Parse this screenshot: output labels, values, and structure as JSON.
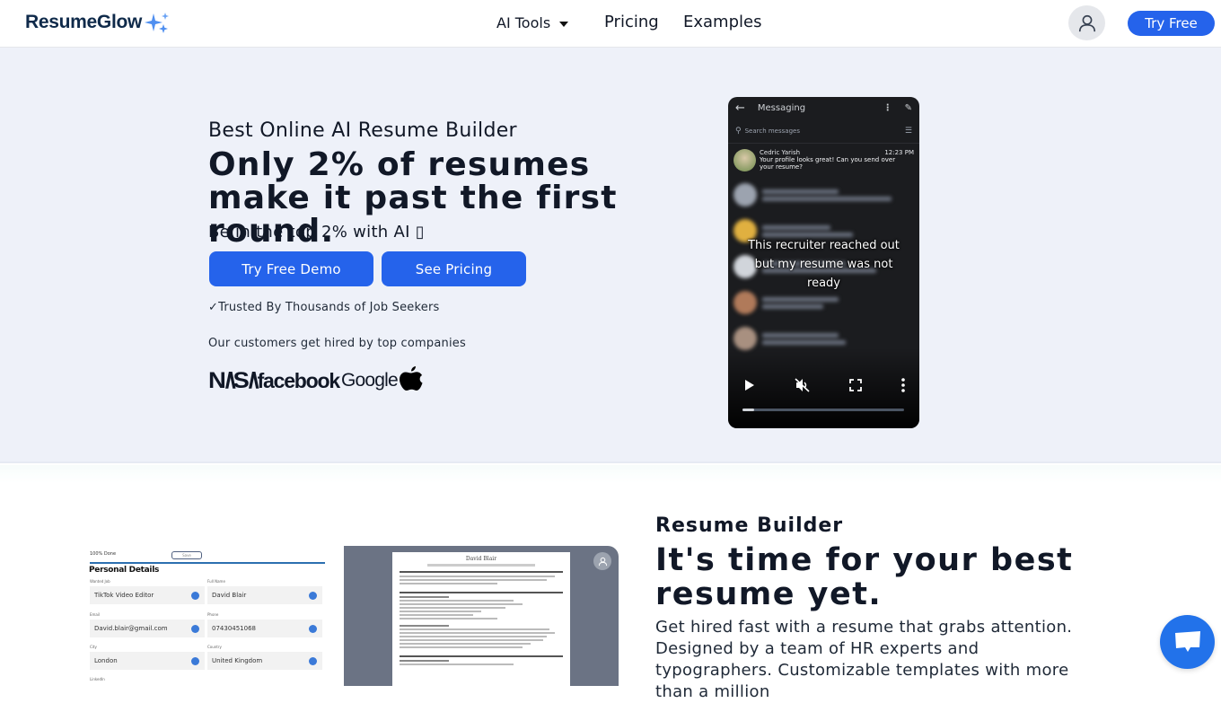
{
  "nav": {
    "brand": "ResumeGlow",
    "items": [
      {
        "label": "AI Tools",
        "has_dropdown": true
      },
      {
        "label": "Pricing"
      },
      {
        "label": "Examples"
      }
    ],
    "cta": "Try Free"
  },
  "hero": {
    "eyebrow": "Best Online AI Resume Builder",
    "headline": "Only 2% of resumes make it past the first round.",
    "subline": "Be in the top 2% with AI ▯",
    "buttons": {
      "demo": "Try Free Demo",
      "pricing": "See Pricing"
    },
    "trusted": "✓Trusted By Thousands of Job Seekers",
    "companies_label": "Our customers get hired by top companies",
    "company_logos": [
      "NASA",
      "facebook",
      "Google",
      "Apple"
    ],
    "video": {
      "app_title": "Messaging",
      "search_placeholder": "Search messages",
      "message": {
        "sender": "Cedric Yarish",
        "time": "12:23 PM",
        "text": "Your profile looks great! Can you send over your resume?"
      },
      "caption": "This recruiter reached out but my resume was not ready",
      "progress": 0.07
    }
  },
  "section2": {
    "eyebrow": "Resume Builder",
    "headline": "It's time for your best resume yet.",
    "body": "Get hired fast with a resume that grabs attention. Designed by a team of HR experts and typographers. Customizable templates with more than a million",
    "form_preview": {
      "progress_label": "100% Done",
      "save_label": "Save",
      "title": "Personal Details",
      "fields": [
        {
          "label": "Wanted Job",
          "value": "TikTok Video Editor"
        },
        {
          "label": "Full Name",
          "value": "David Blair"
        },
        {
          "label": "Email",
          "value": "David.blair@gmail.com"
        },
        {
          "label": "Phone",
          "value": "07430451068"
        },
        {
          "label": "City",
          "value": "London"
        },
        {
          "label": "Country",
          "value": "United Kingdom"
        }
      ],
      "next_label": "LinkedIn"
    },
    "resume_preview": {
      "name": "David Blair",
      "sections": [
        "SUMMARY",
        "EXPERIENCE",
        "EDUCATION"
      ]
    }
  },
  "chat": {
    "icon": "chat-bubble-icon"
  }
}
